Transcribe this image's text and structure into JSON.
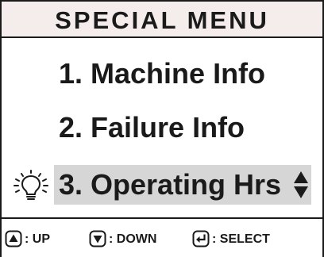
{
  "header": {
    "title": "SPECIAL MENU"
  },
  "menu": {
    "items": [
      {
        "label": "1. Machine Info",
        "selected": false
      },
      {
        "label": "2. Failure Info",
        "selected": false
      },
      {
        "label": "3. Operating Hrs",
        "selected": true
      }
    ],
    "selected_index": 2,
    "indicator_icon": "lightbulb-icon",
    "scroll_icon": "up-down-arrows-icon"
  },
  "footer": {
    "keys": [
      {
        "icon": "up-triangle-key-icon",
        "label": ": UP"
      },
      {
        "icon": "down-triangle-key-icon",
        "label": ": DOWN"
      },
      {
        "icon": "enter-key-icon",
        "label": ": SELECT"
      }
    ]
  },
  "colors": {
    "header_bg": "#f5ecec",
    "selected_bg": "#d6d6d6",
    "text": "#1a1a1a"
  }
}
